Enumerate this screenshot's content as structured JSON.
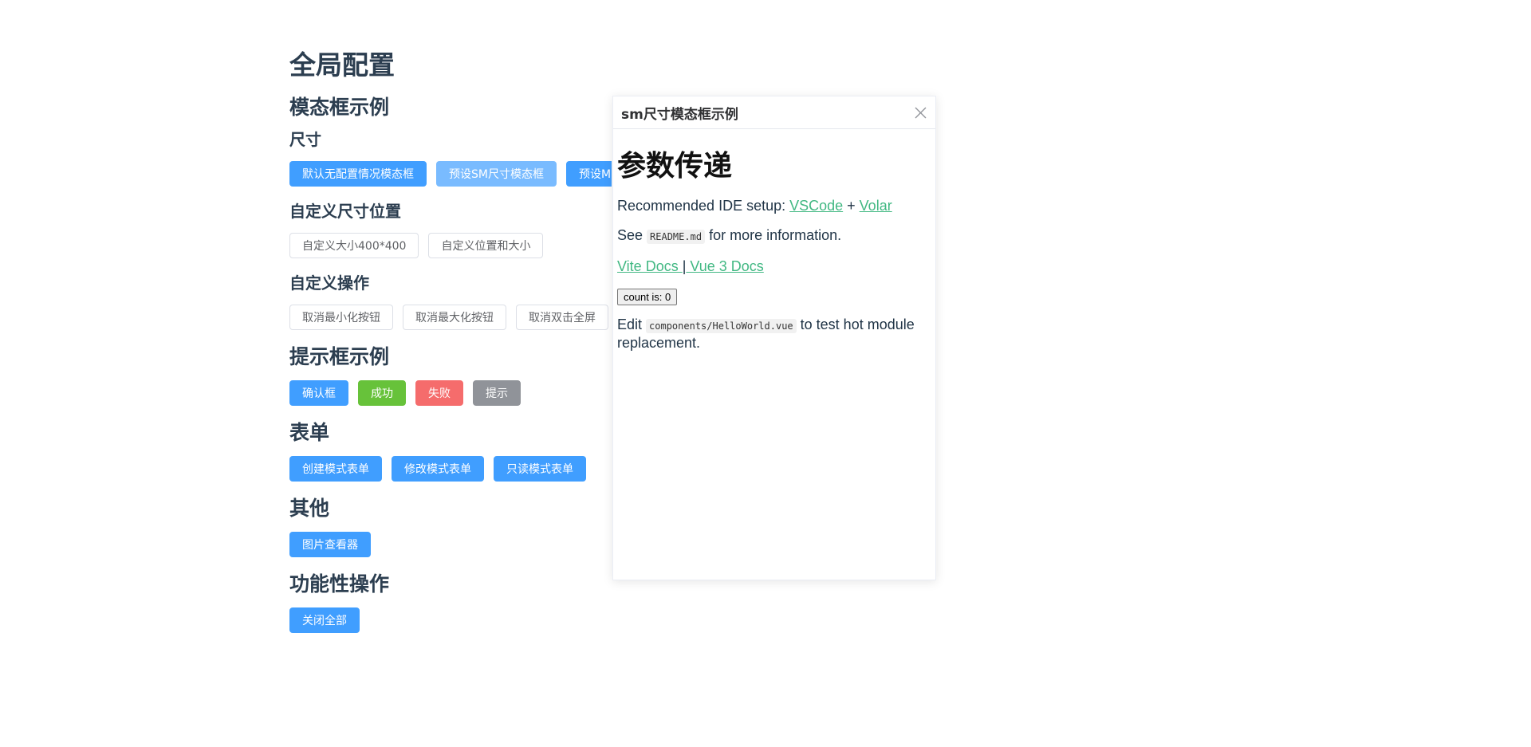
{
  "page": {
    "title": "全局配置",
    "modal_section": {
      "heading": "模态框示例",
      "size": {
        "heading": "尺寸",
        "buttons": [
          "默认无配置情况模态框",
          "预设SM尺寸模态框",
          "预设MD尺寸模态框"
        ]
      },
      "custom_size": {
        "heading": "自定义尺寸位置",
        "buttons": [
          "自定义大小400*400",
          "自定义位置和大小"
        ]
      },
      "custom_ops": {
        "heading": "自定义操作",
        "buttons": [
          "取消最小化按钮",
          "取消最大化按钮",
          "取消双击全屏"
        ]
      }
    },
    "tip_section": {
      "heading": "提示框示例",
      "buttons": [
        "确认框",
        "成功",
        "失败",
        "提示"
      ]
    },
    "form_section": {
      "heading": "表单",
      "buttons": [
        "创建模式表单",
        "修改模式表单",
        "只读模式表单"
      ]
    },
    "other_section": {
      "heading": "其他",
      "buttons": [
        "图片查看器"
      ]
    },
    "func_section": {
      "heading": "功能性操作",
      "buttons": [
        "关闭全部"
      ]
    }
  },
  "modal": {
    "title": "sm尺寸模态框示例",
    "heading": "参数传递",
    "ide_prefix": "Recommended IDE setup: ",
    "ide_link1": "VSCode",
    "ide_plus": " + ",
    "ide_link2": "Volar",
    "see_prefix": "See ",
    "see_code": "README.md",
    "see_suffix": " for more information.",
    "docs_link1": "Vite Docs ",
    "docs_sep": "|",
    "docs_link2": " Vue 3 Docs",
    "count_label": "count is: 0",
    "edit_prefix": "Edit ",
    "edit_code": "components/HelloWorld.vue",
    "edit_suffix": " to test hot module replacement."
  },
  "colors": {
    "primary": "#409eff",
    "success": "#67c23a",
    "danger": "#f56c6c",
    "info": "#909399",
    "link": "#42b883",
    "heading": "#2c3e50"
  }
}
